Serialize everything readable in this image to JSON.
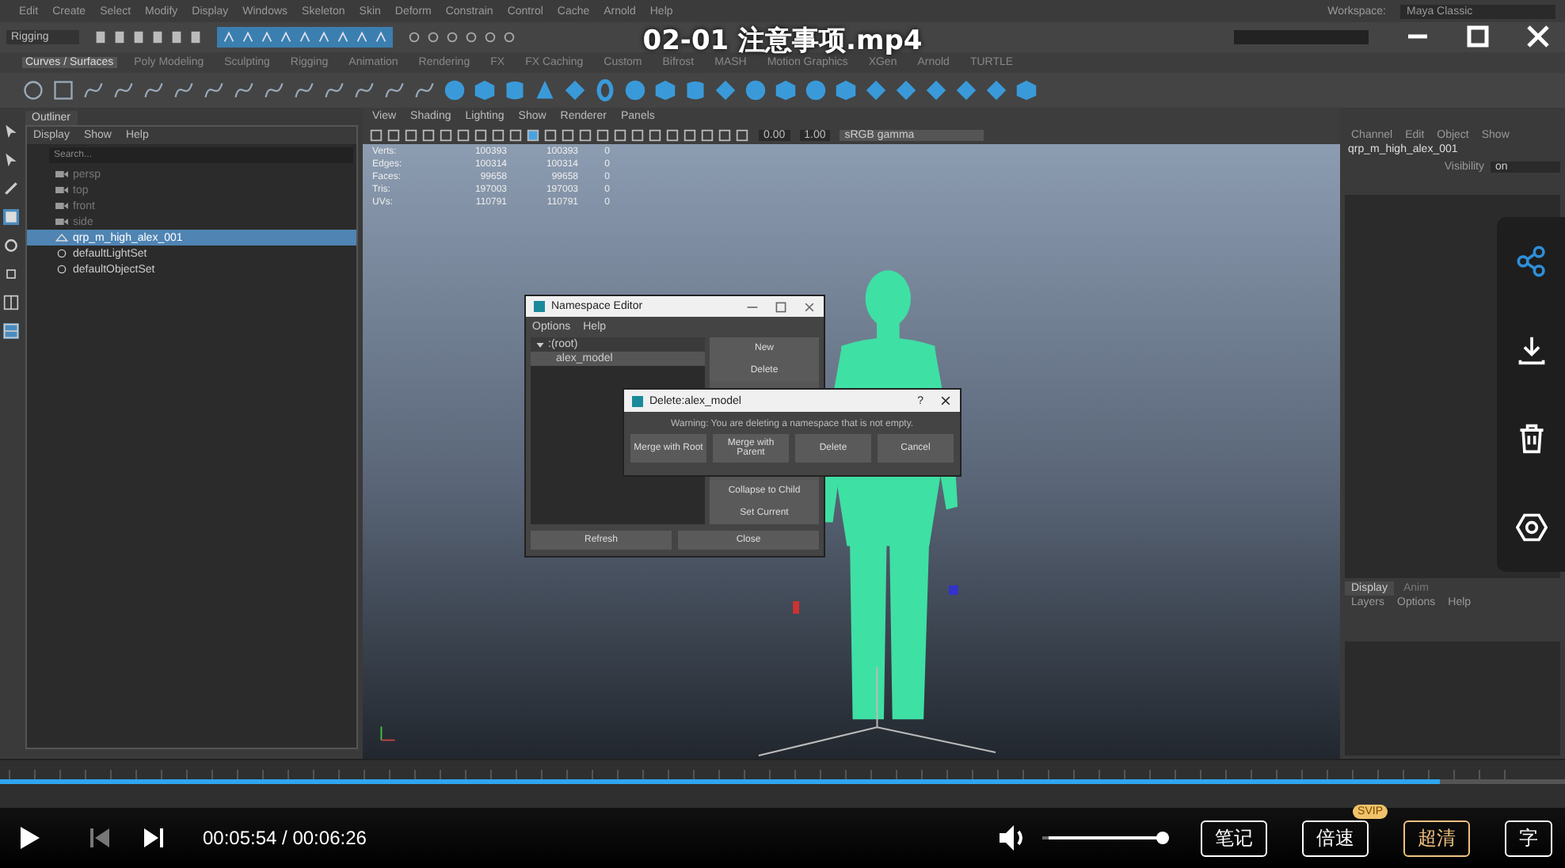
{
  "player": {
    "title": "02-01 注意事项.mp4",
    "time": "00:05:54 / 00:06:26",
    "progress": {
      "level": 0.92
    },
    "volume": {
      "level": 1.0
    },
    "buttons": [
      {
        "label": "笔记",
        "selected": false
      },
      {
        "label": "倍速",
        "selected": false,
        "badge": "SVIP"
      },
      {
        "label": "超清",
        "selected": true
      },
      {
        "label": "字",
        "selected": false
      }
    ]
  },
  "maya": {
    "menu": [
      "Edit",
      "Create",
      "Select",
      "Modify",
      "Display",
      "Windows",
      "Skeleton",
      "Skin",
      "Deform",
      "Constrain",
      "Control",
      "Cache",
      "Arnold",
      "Help"
    ],
    "workspace": {
      "label": "Workspace:",
      "value": "Maya Classic"
    },
    "mode": "Rigging",
    "shelf_tabs": [
      {
        "label": "Curves / Surfaces",
        "selected": true
      },
      {
        "label": "Poly Modeling",
        "selected": false
      },
      {
        "label": "Sculpting",
        "selected": false
      },
      {
        "label": "Rigging",
        "selected": false
      },
      {
        "label": "Animation",
        "selected": false
      },
      {
        "label": "Rendering",
        "selected": false
      },
      {
        "label": "FX",
        "selected": false
      },
      {
        "label": "FX Caching",
        "selected": false
      },
      {
        "label": "Custom",
        "selected": false
      },
      {
        "label": "Bifrost",
        "selected": false
      },
      {
        "label": "MASH",
        "selected": false
      },
      {
        "label": "Motion Graphics",
        "selected": false
      },
      {
        "label": "XGen",
        "selected": false
      },
      {
        "label": "Arnold",
        "selected": false
      },
      {
        "label": "TURTLE",
        "selected": false
      }
    ],
    "outliner": {
      "title": "Outliner",
      "menu": [
        "Display",
        "Show",
        "Help"
      ],
      "search": {
        "placeholder": "Search..."
      },
      "items": [
        {
          "label": "persp",
          "kind": "camera",
          "selected": false,
          "disabled": true
        },
        {
          "label": "top",
          "kind": "camera",
          "selected": false,
          "disabled": true
        },
        {
          "label": "front",
          "kind": "camera",
          "selected": false,
          "disabled": true
        },
        {
          "label": "side",
          "kind": "camera",
          "selected": false,
          "disabled": true
        },
        {
          "label": "qrp_m_high_alex_001",
          "kind": "mesh",
          "selected": true,
          "disabled": false
        },
        {
          "label": "defaultLightSet",
          "kind": "set",
          "selected": false,
          "disabled": false
        },
        {
          "label": "defaultObjectSet",
          "kind": "set",
          "selected": false,
          "disabled": false
        }
      ]
    },
    "viewport": {
      "menu": [
        "View",
        "Shading",
        "Lighting",
        "Show",
        "Renderer",
        "Panels"
      ],
      "exposure": "0.00",
      "gamma": "1.00",
      "color_space": "sRGB gamma",
      "stats": [
        [
          "Verts:",
          "100393",
          "100393",
          "0"
        ],
        [
          "Edges:",
          "100314",
          "100314",
          "0"
        ],
        [
          "Faces:",
          "99658",
          "99658",
          "0"
        ],
        [
          "Tris:",
          "197003",
          "197003",
          "0"
        ],
        [
          "UVs:",
          "110791",
          "110791",
          "0"
        ]
      ]
    },
    "namespace_editor": {
      "title": "Namespace Editor",
      "menu": [
        "Options",
        "Help"
      ],
      "tree": {
        "label": ":(root)",
        "expanded": true,
        "children": [
          {
            "label": "alex_model",
            "selected": true
          }
        ]
      },
      "side_buttons": [
        "New",
        "Delete",
        "Collapse to Child",
        "Set Current"
      ],
      "bottom_buttons": [
        "Refresh",
        "Close"
      ]
    },
    "delete_dialog": {
      "title": "Delete:alex_model",
      "help": "?",
      "message": "Warning: You are deleting a namespace that is not empty.",
      "buttons": [
        "Merge with Root",
        "Merge with Parent",
        "Delete",
        "Cancel"
      ]
    },
    "channel_box": {
      "menu": [
        "Channel",
        "Edit",
        "Object",
        "Show"
      ],
      "object": "qrp_m_high_alex_001",
      "attributes": [
        {
          "name": "Visibility",
          "value": "on"
        }
      ]
    },
    "layer_editor": {
      "tabs": [
        {
          "label": "Display",
          "selected": true
        },
        {
          "label": "Anim",
          "selected": false
        }
      ],
      "menu": [
        "Layers",
        "Options",
        "Help"
      ]
    }
  }
}
